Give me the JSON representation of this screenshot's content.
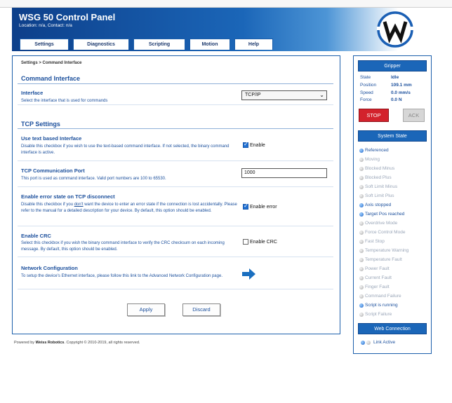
{
  "header": {
    "title": "WSG 50 Control Panel",
    "subtitle": "Location: n/a, Contact: n/a",
    "logo_letter": "W"
  },
  "tabs": [
    {
      "label": "Settings"
    },
    {
      "label": "Diagnostics"
    },
    {
      "label": "Scripting"
    },
    {
      "label": "Motion"
    },
    {
      "label": "Help"
    }
  ],
  "breadcrumb": "Settings > Command Interface",
  "command_interface": {
    "title": "Command Interface",
    "interface_label": "Interface",
    "interface_desc": "Select the interface that is used for commands",
    "interface_value": "TCP/IP"
  },
  "tcp_settings": {
    "title": "TCP Settings",
    "text_iface_label": "Use text based Interface",
    "text_iface_desc": "Disable this checkbox if you wish to use the text-based command interface. If not selected, the binary command interface is active.",
    "text_iface_check": "Enable",
    "port_label": "TCP Communication Port",
    "port_desc": "This port is used as command interface. Valid port numbers are 100 to 65530.",
    "port_value": "1000",
    "err_label": "Enable error state on TCP disconnect",
    "err_desc_1": "Disable this checkbox if you ",
    "err_desc_dont": "don't",
    "err_desc_2": " want the device to enter an error state if the connection is lost accidentally. Please refer to the manual for a detailed description for your device. By default, this option should be enabled.",
    "err_check": "Enable error",
    "crc_label": "Enable CRC",
    "crc_desc": "Select this checkbox if you wish the binary command interface to verify the CRC checksum on each incoming message. By default, this option should be enabled.",
    "crc_check": "Enable CRC",
    "net_label": "Network Configuration",
    "net_desc": "To setup the device's Ethernet interface, please follow this link to the Advanced Network Configuration page."
  },
  "buttons": {
    "apply": "Apply",
    "discard": "Discard"
  },
  "footer": {
    "prefix": "Powered by ",
    "company": "Weiss Robotics",
    "suffix": ". Copyright © 2010-2019, all rights reserved."
  },
  "gripper": {
    "title": "Gripper",
    "state_label": "State",
    "state_value": "Idle",
    "position_label": "Position",
    "position_value": "109.1 mm",
    "speed_label": "Speed",
    "speed_value": "0.0 mm/s",
    "force_label": "Force",
    "force_value": "0.0 N",
    "stop": "STOP",
    "ack": "ACK"
  },
  "system_state": {
    "title": "System State",
    "items": [
      {
        "label": "Referenced",
        "on": true
      },
      {
        "label": "Moving",
        "on": false
      },
      {
        "label": "Blocked Minus",
        "on": false
      },
      {
        "label": "Blocked Plus",
        "on": false
      },
      {
        "label": "Soft Limit Minus",
        "on": false
      },
      {
        "label": "Soft Limit Plus",
        "on": false
      },
      {
        "label": "Axis stopped",
        "on": true
      },
      {
        "label": "Target Pos reached",
        "on": true
      },
      {
        "label": "Overdrive Mode",
        "on": false
      },
      {
        "label": "Force Control Mode",
        "on": false
      },
      {
        "label": "Fast Stop",
        "on": false
      },
      {
        "label": "Temperature Warning",
        "on": false
      },
      {
        "label": "Temperature Fault",
        "on": false
      },
      {
        "label": "Power Fault",
        "on": false
      },
      {
        "label": "Current Fault",
        "on": false
      },
      {
        "label": "Finger Fault",
        "on": false
      },
      {
        "label": "Command Failure",
        "on": false
      },
      {
        "label": "Script is running",
        "on": true
      },
      {
        "label": "Script Failure",
        "on": false
      }
    ]
  },
  "web_connection": {
    "title": "Web Connection",
    "link_label": "Link Active"
  },
  "colors": {
    "brand_blue": "#1b66b8",
    "stop_red": "#d3222c",
    "status_on": "#1e64c8",
    "status_off": "#aaaaaa"
  }
}
